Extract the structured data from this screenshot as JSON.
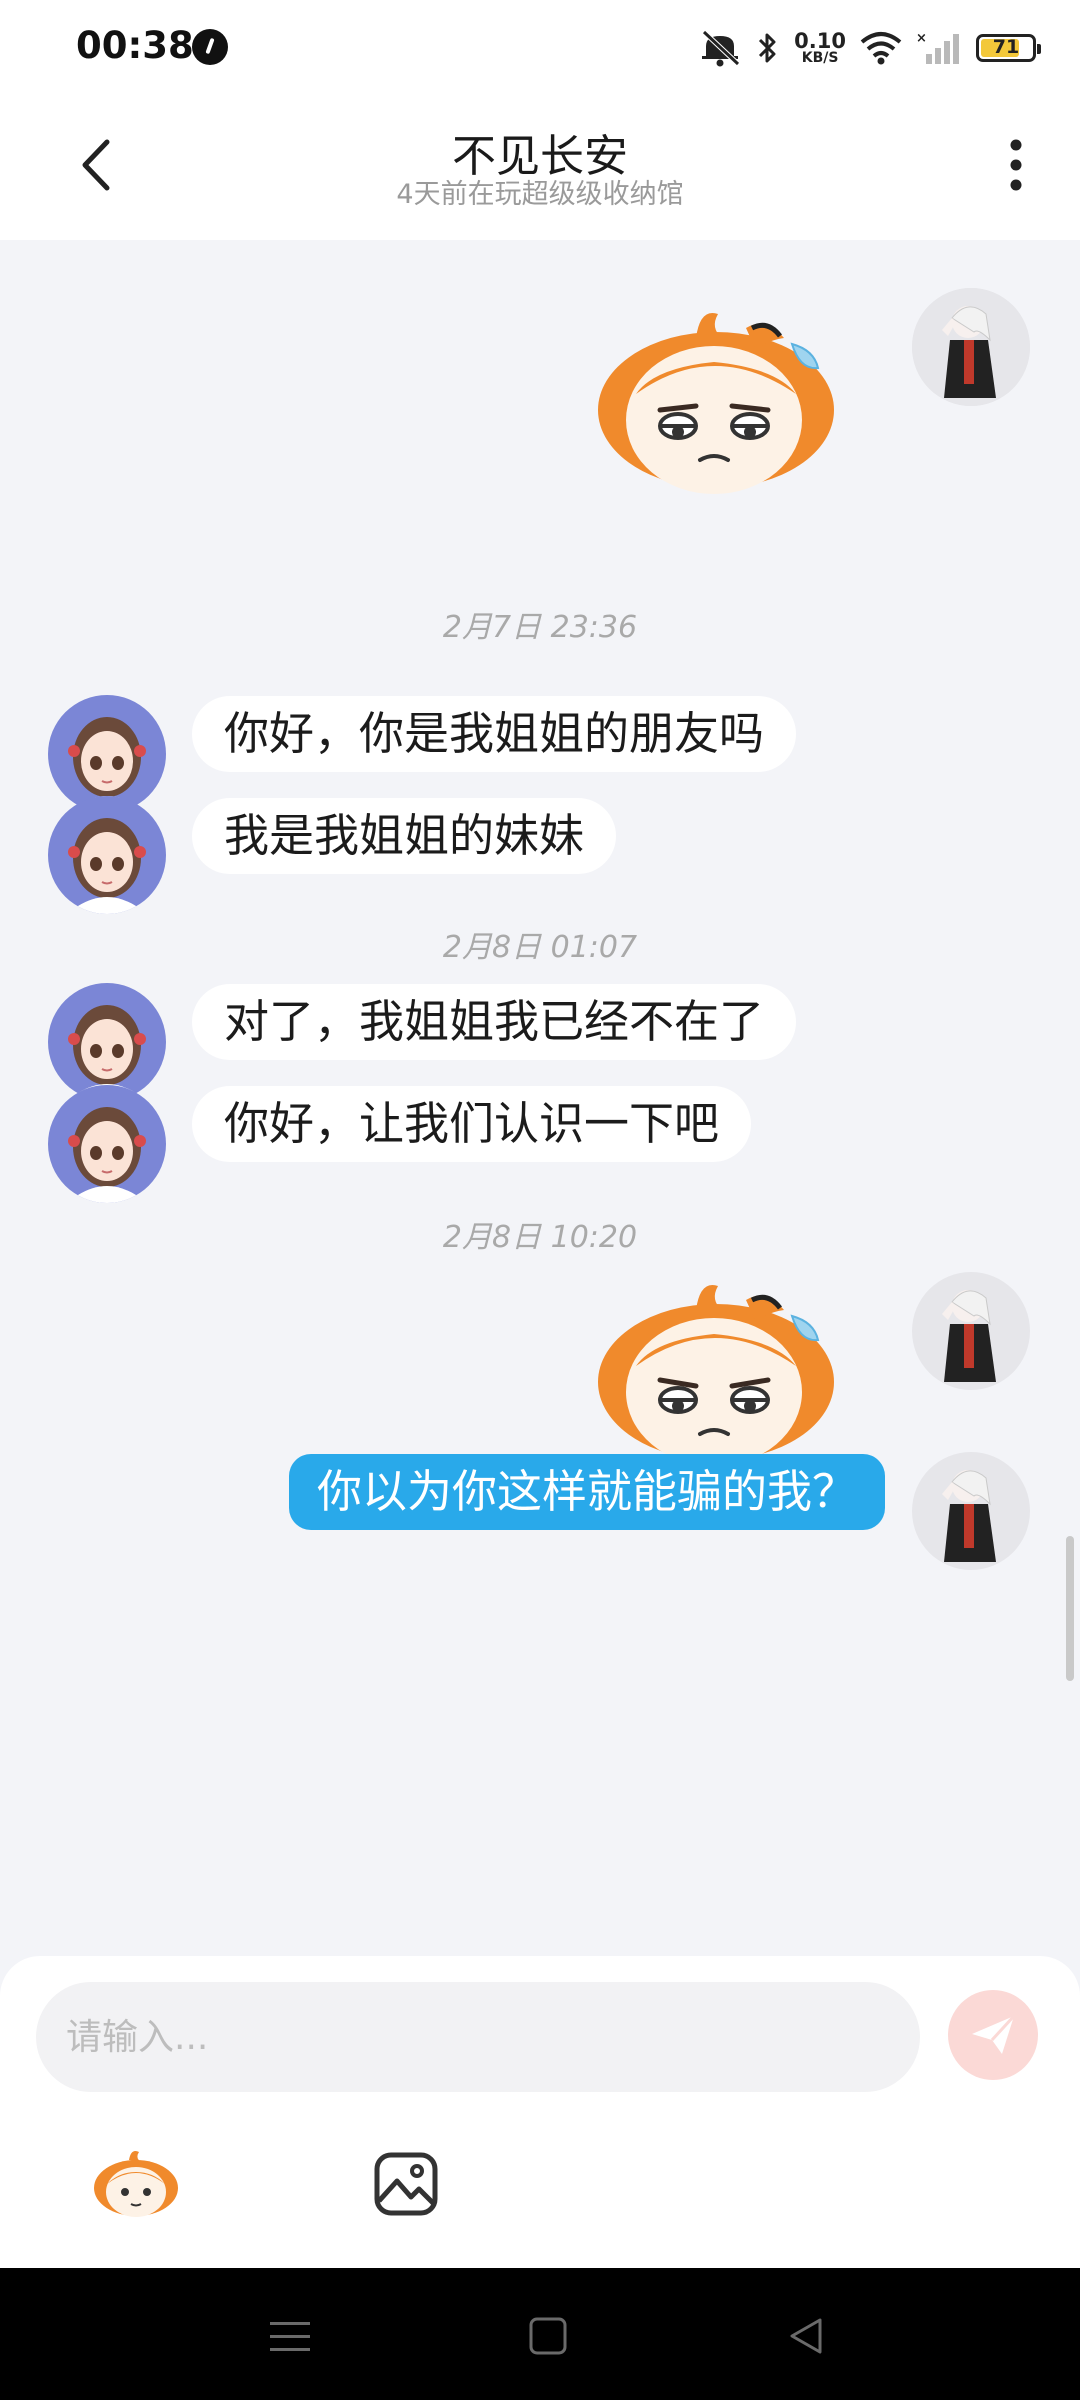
{
  "status_bar": {
    "time": "00:38",
    "net_speed_value": "0.10",
    "net_speed_unit": "KB/S",
    "battery_level": "71",
    "icons": [
      "mute-icon",
      "bluetooth-icon",
      "wifi-icon",
      "signal-icon",
      "battery-icon"
    ]
  },
  "header": {
    "title": "不见长安",
    "subtitle": "4天前在玩超级级收纳馆",
    "back_icon": "chevron-left-icon",
    "more_icon": "more-vertical-icon"
  },
  "chat": {
    "messages": [
      {
        "kind": "sticker",
        "side": "right",
        "sticker": "orange-hair-annoyed-face-sticker"
      },
      {
        "kind": "timestamp",
        "text": "2月7日 23:36"
      },
      {
        "kind": "text",
        "side": "left",
        "text": "你好，你是我姐姐的朋友吗"
      },
      {
        "kind": "text",
        "side": "left",
        "text": "我是我姐姐的妹妹"
      },
      {
        "kind": "timestamp",
        "text": "2月8日 01:07"
      },
      {
        "kind": "text",
        "side": "left",
        "text": "对了，我姐姐我已经不在了"
      },
      {
        "kind": "text",
        "side": "left",
        "text": "你好，让我们认识一下吧"
      },
      {
        "kind": "timestamp",
        "text": "2月8日 10:20"
      },
      {
        "kind": "sticker",
        "side": "right",
        "sticker": "orange-hair-annoyed-face-sticker"
      },
      {
        "kind": "text",
        "side": "right",
        "text": "你以为你这样就能骗的我？"
      }
    ]
  },
  "composer": {
    "placeholder": "请输入...",
    "value": "",
    "send_icon": "send-icon",
    "emoji_icon": "emoji-sticker-icon",
    "image_icon": "image-icon"
  },
  "colors": {
    "outgoing_bubble": "#29a9ea",
    "incoming_bubble": "#ffffff",
    "chat_background": "#f3f4f8",
    "send_button": "#fbd9d6"
  }
}
